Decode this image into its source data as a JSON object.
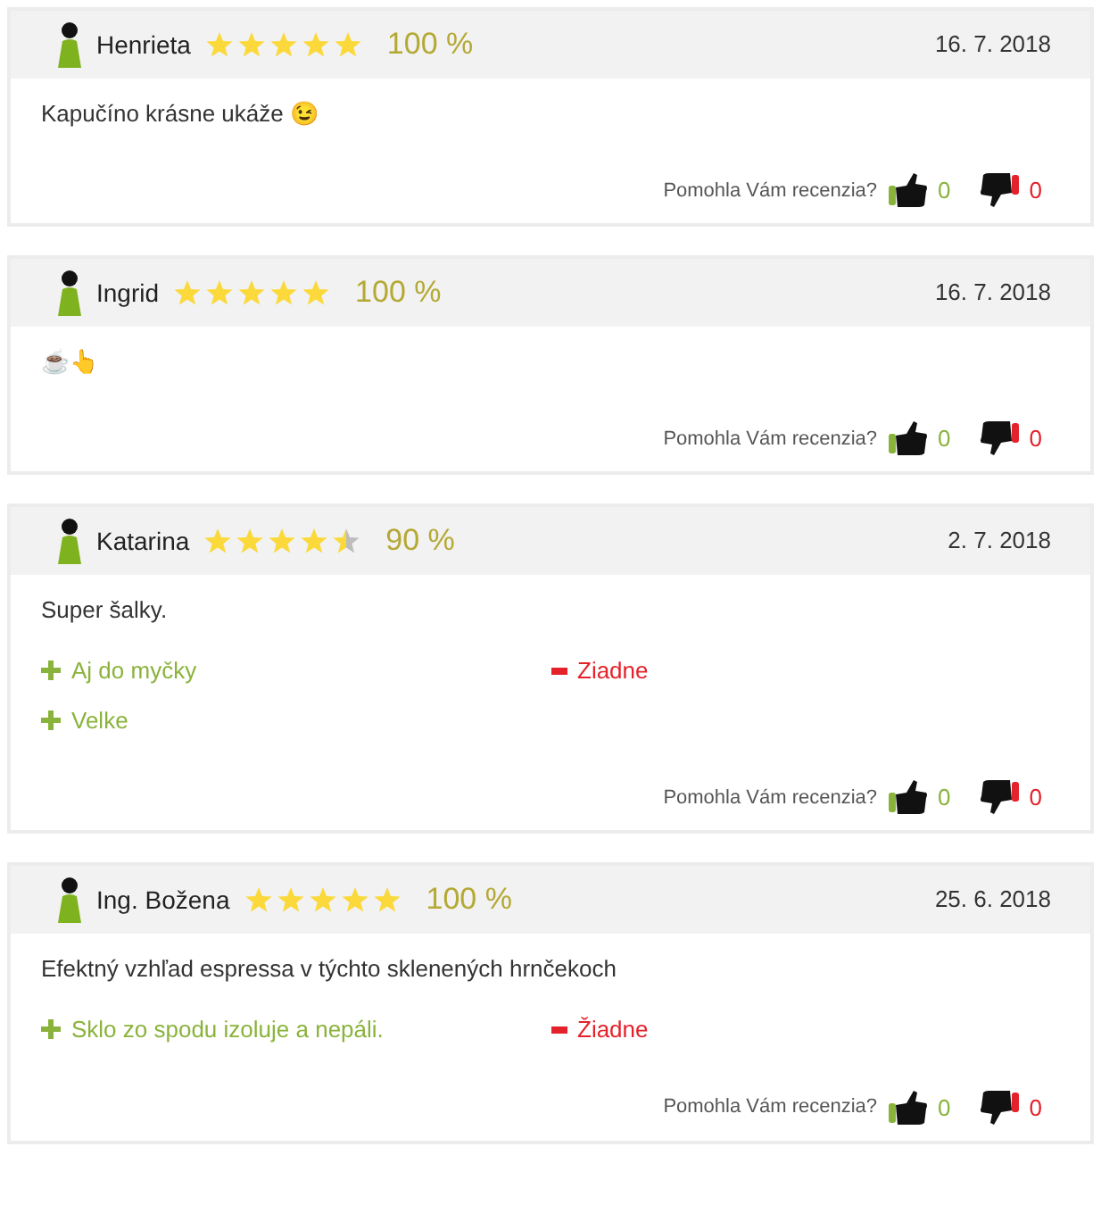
{
  "reviews": [
    {
      "author": "Henrieta",
      "stars": 5,
      "percent": "100 %",
      "date": "16. 7. 2018",
      "text": "Kapučíno krásne ukáže 😉",
      "helpful_label": "Pomohla Vám recenzia?",
      "likes": "0",
      "dislikes": "0"
    },
    {
      "author": "Ingrid",
      "stars": 5,
      "percent": "100 %",
      "date": "16. 7. 2018",
      "text": "☕👆",
      "helpful_label": "Pomohla Vám recenzia?",
      "likes": "0",
      "dislikes": "0"
    },
    {
      "author": "Katarina",
      "stars": 4.5,
      "percent": "90 %",
      "date": "2. 7. 2018",
      "text": "Super šalky.",
      "pros": [
        "Aj do myčky",
        "Velke"
      ],
      "cons": [
        "Ziadne"
      ],
      "helpful_label": "Pomohla Vám recenzia?",
      "likes": "0",
      "dislikes": "0"
    },
    {
      "author": "Ing. Božena",
      "stars": 5,
      "percent": "100 %",
      "date": "25. 6. 2018",
      "text": "Efektný vzhľad espressa v týchto sklenených hrnčekoch",
      "pros": [
        "Sklo zo spodu izoluje a nepáli."
      ],
      "cons": [
        "Žiadne"
      ],
      "helpful_label": "Pomohla Vám recenzia?",
      "likes": "0",
      "dislikes": "0"
    }
  ]
}
